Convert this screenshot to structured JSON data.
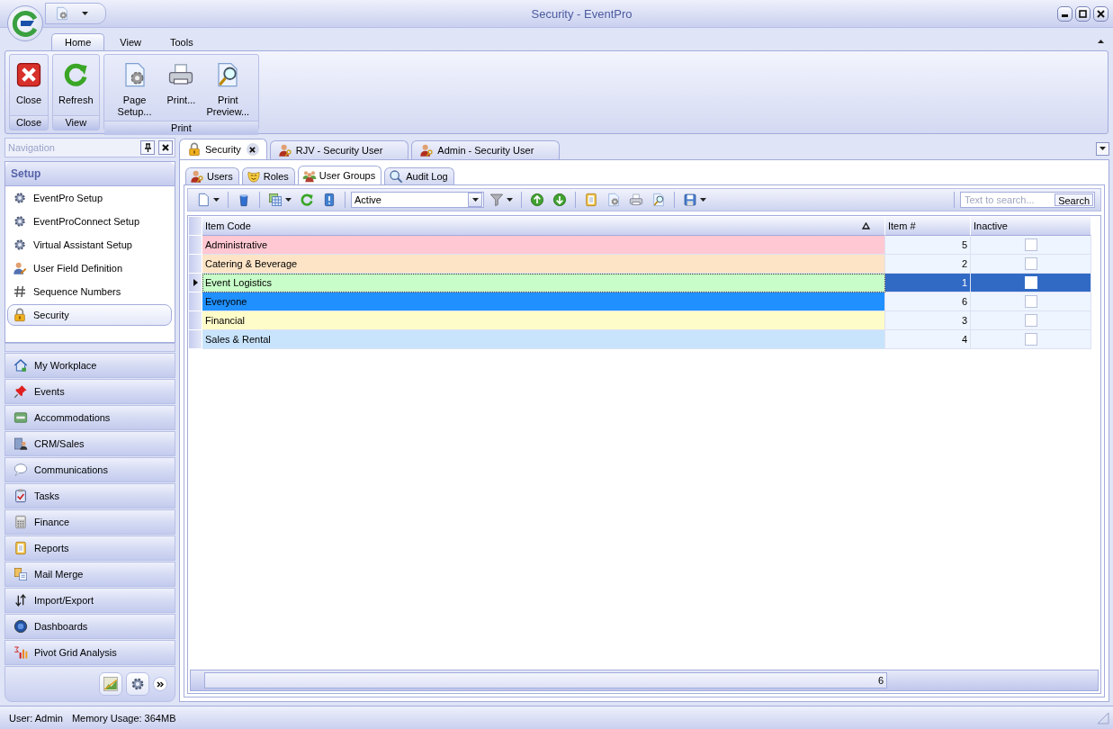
{
  "window": {
    "title": "Security - EventPro"
  },
  "ribbon": {
    "tabs": [
      {
        "label": "Home",
        "selected": true
      },
      {
        "label": "View",
        "selected": false
      },
      {
        "label": "Tools",
        "selected": false
      }
    ],
    "groups": [
      {
        "label": "Close",
        "buttons": [
          {
            "label": "Close",
            "kind": "close"
          }
        ]
      },
      {
        "label": "View",
        "buttons": [
          {
            "label": "Refresh",
            "kind": "refresh"
          }
        ]
      },
      {
        "label": "Print",
        "buttons": [
          {
            "label": "Page Setup...",
            "kind": "page-setup"
          },
          {
            "label": "Print...",
            "kind": "print"
          },
          {
            "label": "Print Preview...",
            "kind": "preview"
          }
        ]
      }
    ]
  },
  "navigation": {
    "title": "Navigation",
    "section": "Setup",
    "items": [
      {
        "label": "EventPro Setup",
        "kind": "gear",
        "selected": false
      },
      {
        "label": "EventProConnect Setup",
        "kind": "gear",
        "selected": false
      },
      {
        "label": "Virtual Assistant Setup",
        "kind": "gear",
        "selected": false
      },
      {
        "label": "User Field Definition",
        "kind": "user-edit",
        "selected": false
      },
      {
        "label": "Sequence Numbers",
        "kind": "hash",
        "selected": false
      },
      {
        "label": "Security",
        "kind": "lock",
        "selected": true
      }
    ],
    "modules": [
      {
        "label": "My Workplace",
        "kind": "home"
      },
      {
        "label": "Events",
        "kind": "pin"
      },
      {
        "label": "Accommodations",
        "kind": "bed"
      },
      {
        "label": "CRM/Sales",
        "kind": "crm"
      },
      {
        "label": "Communications",
        "kind": "chat"
      },
      {
        "label": "Tasks",
        "kind": "tasks"
      },
      {
        "label": "Finance",
        "kind": "calculator"
      },
      {
        "label": "Reports",
        "kind": "report"
      },
      {
        "label": "Mail Merge",
        "kind": "mail-merge"
      },
      {
        "label": "Import/Export",
        "kind": "import-export"
      },
      {
        "label": "Dashboards",
        "kind": "dashboard"
      },
      {
        "label": "Pivot Grid Analysis",
        "kind": "pivot"
      }
    ]
  },
  "document_tabs": [
    {
      "label": "Security",
      "kind": "lock",
      "selected": true
    },
    {
      "label": "RJV - Security User",
      "kind": "user-key",
      "selected": false
    },
    {
      "label": "Admin - Security User",
      "kind": "user-key",
      "selected": false
    }
  ],
  "sub_tabs": [
    {
      "label": "Users",
      "kind": "user-key",
      "selected": false
    },
    {
      "label": "Roles",
      "kind": "mask",
      "selected": false
    },
    {
      "label": "User Groups",
      "kind": "group",
      "selected": true
    },
    {
      "label": "Audit Log",
      "kind": "log",
      "selected": false
    }
  ],
  "toolbar": {
    "filter": "Active",
    "search": {
      "placeholder": "Text to search...",
      "button": "Search"
    }
  },
  "grid": {
    "columns": [
      {
        "label": "Item Code",
        "sorted_ascending": true
      },
      {
        "label": "Item #"
      },
      {
        "label": "Inactive"
      }
    ],
    "rows": [
      {
        "item_code": "Administrative",
        "item_number": "5",
        "inactive": false,
        "color": "#ffc8d2",
        "selected": false
      },
      {
        "item_code": "Catering & Beverage",
        "item_number": "2",
        "inactive": false,
        "color": "#fde4c6",
        "selected": false
      },
      {
        "item_code": "Event Logistics",
        "item_number": "1",
        "inactive": false,
        "color": "#c8fcc8",
        "selected": true
      },
      {
        "item_code": "Everyone",
        "item_number": "6",
        "inactive": false,
        "color": "#2090fe",
        "selected": false
      },
      {
        "item_code": "Financial",
        "item_number": "3",
        "inactive": false,
        "color": "#fefcc8",
        "selected": false
      },
      {
        "item_code": "Sales & Rental",
        "item_number": "4",
        "inactive": false,
        "color": "#c8e4fc",
        "selected": false
      }
    ],
    "footer_count": "6"
  },
  "status_bar": {
    "user": "User: Admin",
    "memory": "Memory Usage: 364MB"
  }
}
